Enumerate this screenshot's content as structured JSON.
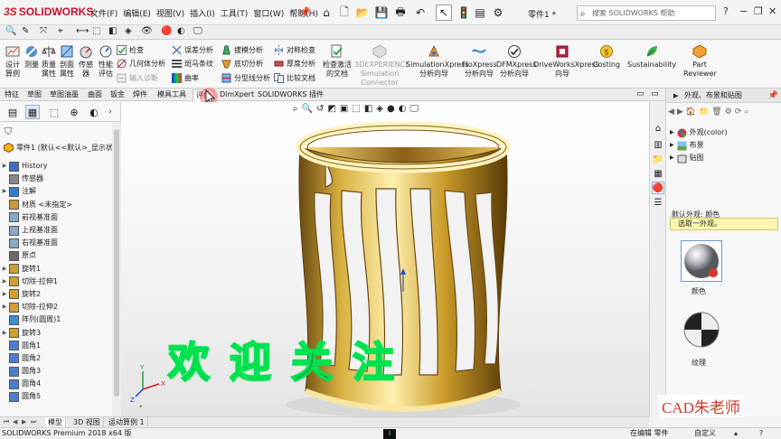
{
  "app": {
    "logo_ds": "3S",
    "logo_name": "SOLIDWORKS",
    "document_title": "零件1 *",
    "search_placeholder": "搜索 SOLIDWORKS 帮助"
  },
  "menu": [
    "文件(F)",
    "编辑(E)",
    "视图(V)",
    "插入(I)",
    "工具(T)",
    "窗口(W)",
    "帮助(H)"
  ],
  "ribbon": {
    "design_study": [
      "设计",
      "算例"
    ],
    "measure": "测量",
    "mass_props": [
      "质量",
      "属性"
    ],
    "section_props": [
      "剖面",
      "属性"
    ],
    "sensor": "传感器",
    "performance": [
      "性能",
      "评估"
    ],
    "check": "检查",
    "geometry_analysis": "几何体分析",
    "import_diagnostics": "输入诊断",
    "deviation": "误差分析",
    "zebra": "斑马条纹",
    "curvature": "曲率",
    "draft": "拔模分析",
    "undercut": "底切分析",
    "parting_line": "分型线分析",
    "symmetry": "对称检查",
    "thickness": "厚度分析",
    "compare": "比较文档",
    "check_active": [
      "检查激活",
      "的文档"
    ],
    "x3d": [
      "3DEXPERIENCE",
      "Simulation",
      "Connector"
    ],
    "simxpress": [
      "SimulationXpress",
      "分析向导"
    ],
    "floxpress": [
      "FloXpress",
      "分析向导"
    ],
    "dfmxpress": [
      "DFMXpress",
      "分析向导"
    ],
    "driveworks": [
      "DriveWorksXpress",
      "向导"
    ],
    "costing": "Costing",
    "sustainability": "Sustainability",
    "part_reviewer": [
      "Part",
      "Reviewer"
    ]
  },
  "tabs": [
    "特征",
    "草图",
    "草图油墨",
    "曲面",
    "钣金",
    "焊件",
    "模具工具",
    "评估",
    "DimXpert",
    "SOLIDWORKS 插件"
  ],
  "tree": {
    "root": "零件1 (默认<<默认>_显示状",
    "items": [
      {
        "label": "History",
        "arrow": "▶"
      },
      {
        "label": "传感器",
        "arrow": ""
      },
      {
        "label": "注解",
        "arrow": "▶"
      },
      {
        "label": "材质 <未指定>",
        "arrow": ""
      },
      {
        "label": "前视基准面",
        "arrow": ""
      },
      {
        "label": "上视基准面",
        "arrow": ""
      },
      {
        "label": "右视基准面",
        "arrow": ""
      },
      {
        "label": "原点",
        "arrow": ""
      },
      {
        "label": "旋转1",
        "arrow": "▶"
      },
      {
        "label": "切除-拉伸1",
        "arrow": "▶"
      },
      {
        "label": "旋转2",
        "arrow": "▶"
      },
      {
        "label": "切除-拉伸2",
        "arrow": "▶"
      },
      {
        "label": "阵列(圆周)1",
        "arrow": ""
      },
      {
        "label": "旋转3",
        "arrow": "▶"
      },
      {
        "label": "圆角1",
        "arrow": ""
      },
      {
        "label": "圆角2",
        "arrow": ""
      },
      {
        "label": "圆角3",
        "arrow": ""
      },
      {
        "label": "圆角4",
        "arrow": ""
      },
      {
        "label": "圆角5",
        "arrow": ""
      }
    ]
  },
  "right_panel": {
    "title": "外观、布景和贴图",
    "tree": [
      "外观(color)",
      "布景",
      "贴图"
    ],
    "default_label": "默认外观: 颜色",
    "tip": "选取一外观。",
    "swatch1": "颜色",
    "swatch2": "纹理"
  },
  "overlay": {
    "welcome": "欢迎关注",
    "watermark": "CAD朱老师"
  },
  "bottom_tabs": [
    "模型",
    "3D 视图",
    "运动算例 1"
  ],
  "status": {
    "product": "SOLIDWORKS Premium 2018 x64 版",
    "editing": "在编辑 零件",
    "custom": "自定义"
  },
  "colors": {
    "gold": "#c9a02e",
    "tip_bg": "#fff7b0",
    "welcome_outline": "#00e24f",
    "watermark": "#d23a2a"
  }
}
